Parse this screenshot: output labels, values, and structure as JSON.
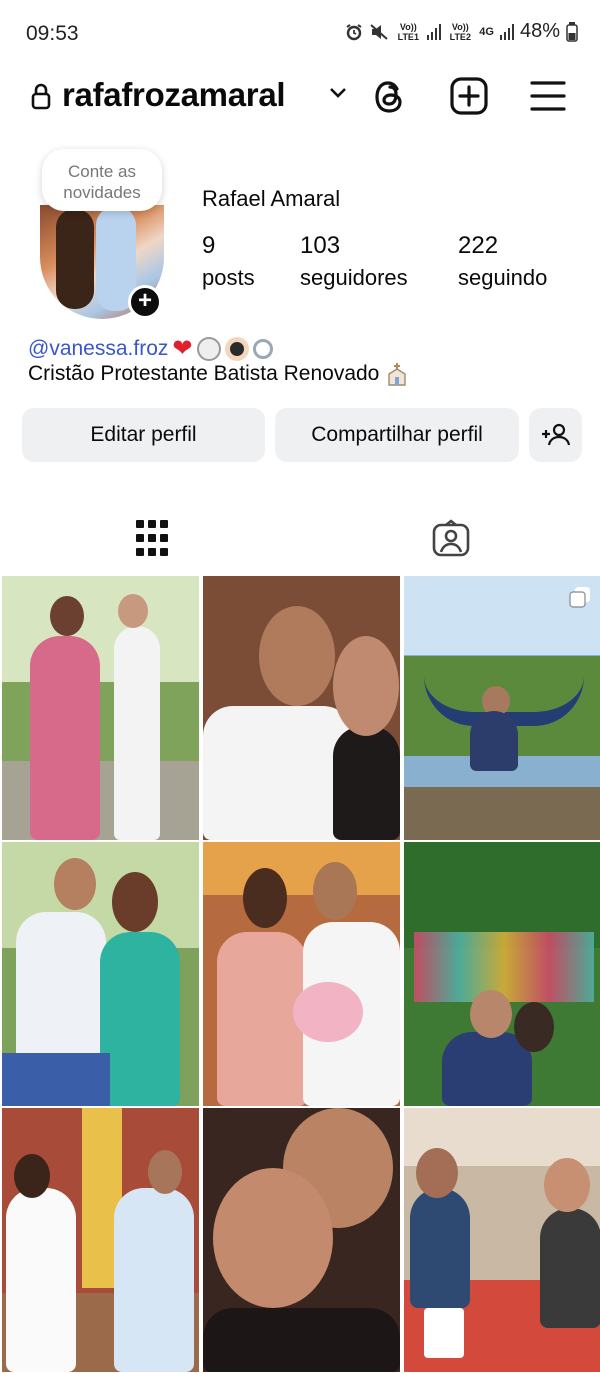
{
  "status_bar": {
    "time": "09:53",
    "sim1": "Vo)) LTE1",
    "sim2": "Vo)) LTE2",
    "network": "4G",
    "battery": "48%",
    "icons": [
      "alarm-icon",
      "mute-icon",
      "signal-icon",
      "battery-icon"
    ]
  },
  "header": {
    "username": "rafafrozamaral",
    "icons": [
      "lock-icon",
      "chevron-down-icon",
      "threads-icon",
      "new-post-icon",
      "menu-icon"
    ]
  },
  "profile": {
    "note_line1": "Conte as",
    "note_line2": "novidades",
    "full_name": "Rafael Amaral",
    "stats": {
      "posts": {
        "value": "9",
        "label": "posts"
      },
      "followers": {
        "value": "103",
        "label": "seguidores"
      },
      "following": {
        "value": "222",
        "label": "seguindo"
      }
    },
    "bio_mention": "@vanessa.froz",
    "bio_text": "Cristão Protestante Batista Renovado"
  },
  "actions": {
    "edit": "Editar perfil",
    "share": "Compartilhar perfil",
    "add_person_icon": "add-person-icon"
  },
  "tabs": {
    "items": [
      "grid-tab",
      "tagged-tab"
    ],
    "active": "grid-tab"
  },
  "posts": [
    {
      "id": "post-1",
      "scene": "couple-in-pink-dress-outdoors"
    },
    {
      "id": "post-2",
      "scene": "couple-selfie-indoors"
    },
    {
      "id": "post-3",
      "scene": "man-in-hammock",
      "multiple": true
    },
    {
      "id": "post-4",
      "scene": "couple-embracing-garden"
    },
    {
      "id": "post-5",
      "scene": "couple-with-bouquet"
    },
    {
      "id": "post-6",
      "scene": "couple-selfie-garden"
    },
    {
      "id": "post-7",
      "scene": "couple-holding-hands"
    },
    {
      "id": "post-8",
      "scene": "couple-close-selfie"
    },
    {
      "id": "post-9",
      "scene": "family-at-restaurant"
    }
  ],
  "colors": {
    "mention": "#3a57c9",
    "button_bg": "#eff0f2",
    "text": "#0a0a0a"
  }
}
